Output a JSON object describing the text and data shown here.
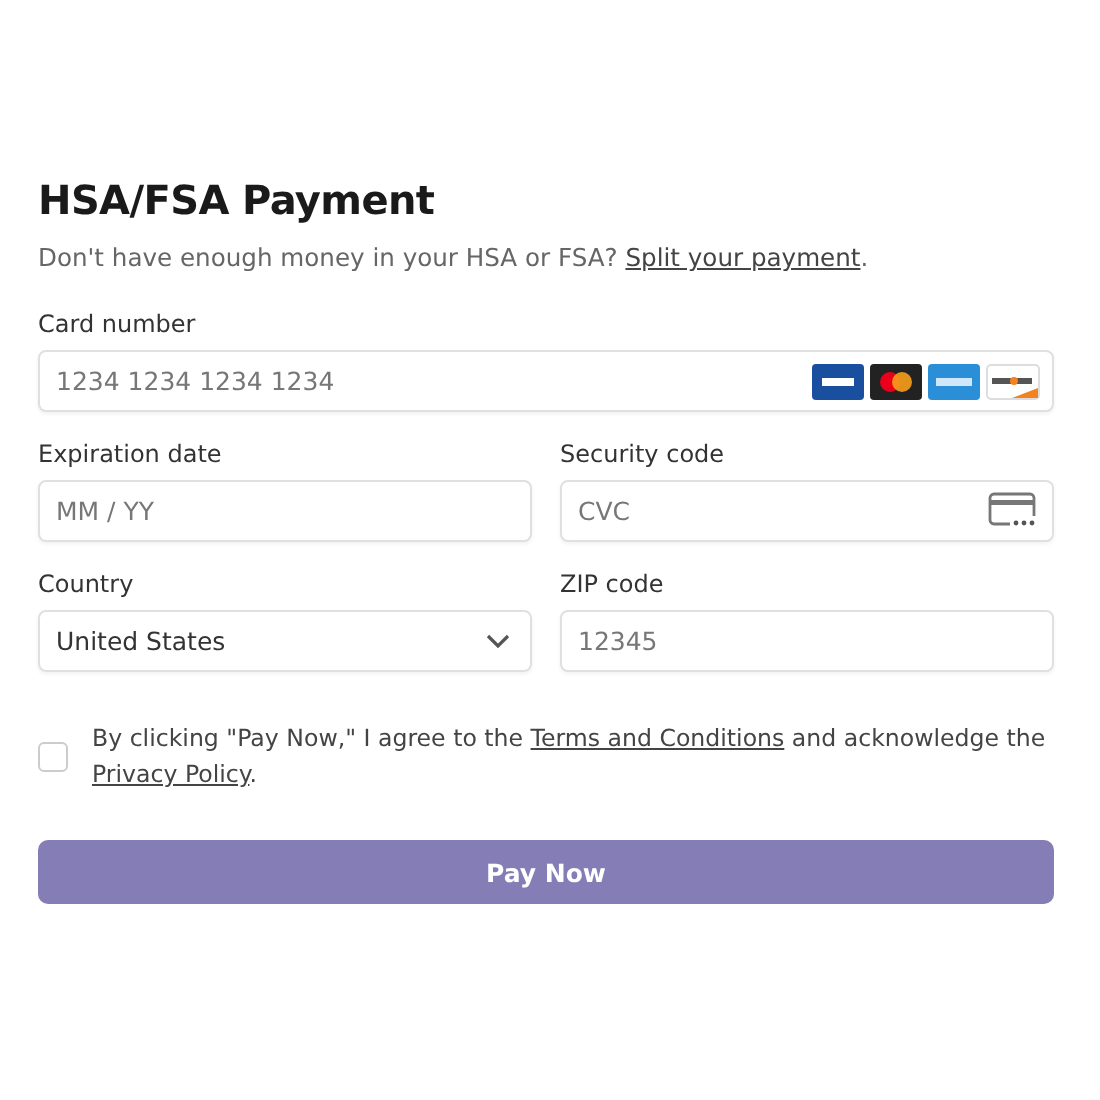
{
  "title": "HSA/FSA Payment",
  "subtitle": {
    "text": "Don't have enough money in your HSA or FSA? ",
    "link": "Split your payment",
    "end": "."
  },
  "fields": [
    {
      "kind": "card",
      "label": "Card number",
      "placeholder": "1234 1234 1234 1234"
    },
    {
      "kind": "text",
      "label": "Expiration date",
      "placeholder": "MM / YY"
    },
    {
      "kind": "cvc",
      "label": "Security code",
      "placeholder": "CVC"
    },
    {
      "kind": "select",
      "label": "Country",
      "value": "United States"
    },
    {
      "kind": "text",
      "label": "ZIP code",
      "placeholder": "12345"
    }
  ],
  "agreement": {
    "checked": false,
    "parts": [
      {
        "kind": "text",
        "text": "By clicking \"Pay Now,\" I agree to the "
      },
      {
        "kind": "link",
        "text": "Terms and Conditions"
      },
      {
        "kind": "text",
        "text": " and acknowledge the "
      },
      {
        "kind": "link",
        "text": "Privacy Policy"
      },
      {
        "kind": "text",
        "text": "."
      }
    ]
  },
  "button": {
    "label": "Pay Now"
  }
}
